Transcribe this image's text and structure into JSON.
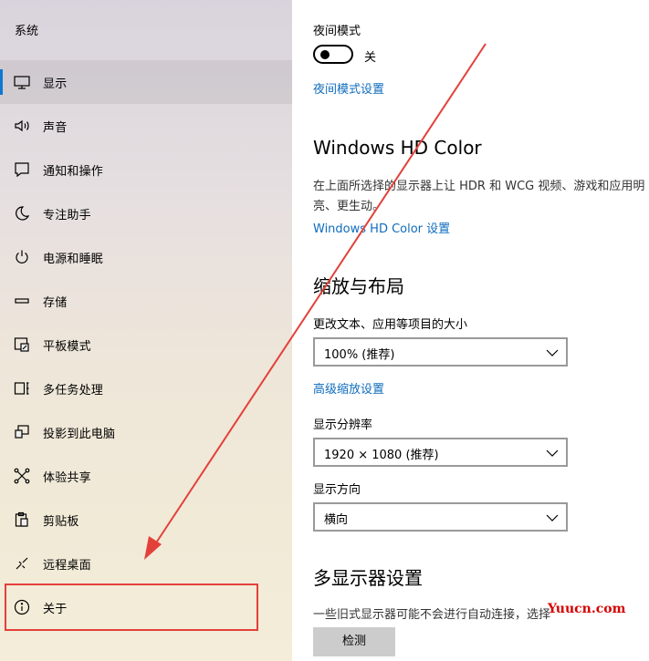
{
  "sidebar": {
    "heading": "系统",
    "items": [
      {
        "label": "显示",
        "icon": "monitor-icon"
      },
      {
        "label": "声音",
        "icon": "speaker-icon"
      },
      {
        "label": "通知和操作",
        "icon": "notification-icon"
      },
      {
        "label": "专注助手",
        "icon": "moon-icon"
      },
      {
        "label": "电源和睡眠",
        "icon": "power-icon"
      },
      {
        "label": "存储",
        "icon": "storage-icon"
      },
      {
        "label": "平板模式",
        "icon": "tablet-mode-icon"
      },
      {
        "label": "多任务处理",
        "icon": "multitasking-icon"
      },
      {
        "label": "投影到此电脑",
        "icon": "project-icon"
      },
      {
        "label": "体验共享",
        "icon": "share-icon"
      },
      {
        "label": "剪贴板",
        "icon": "clipboard-icon"
      },
      {
        "label": "远程桌面",
        "icon": "remote-desktop-icon"
      },
      {
        "label": "关于",
        "icon": "info-icon"
      }
    ],
    "active_index": 0
  },
  "main": {
    "night_mode": {
      "label": "夜间模式",
      "toggle_state": "关",
      "settings_link": "夜间模式设置"
    },
    "hd_color": {
      "title": "Windows HD Color",
      "description": "在上面所选择的显示器上让 HDR 和 WCG 视频、游戏和应用明亮、更生动。",
      "link": "Windows HD Color 设置"
    },
    "scale_layout": {
      "title": "缩放与布局",
      "size_label": "更改文本、应用等项目的大小",
      "size_value": "100% (推荐)",
      "advanced_link": "高级缩放设置",
      "resolution_label": "显示分辨率",
      "resolution_value": "1920 × 1080 (推荐)",
      "orientation_label": "显示方向",
      "orientation_value": "横向"
    },
    "multi_display": {
      "title": "多显示器设置",
      "description": "一些旧式显示器可能不会进行自动连接，选择",
      "detect_button": "检测"
    }
  },
  "watermark": "Yuucn.com",
  "colors": {
    "accent": "#0f78d4",
    "link": "#0f6cbd",
    "highlight": "#e3403a"
  }
}
